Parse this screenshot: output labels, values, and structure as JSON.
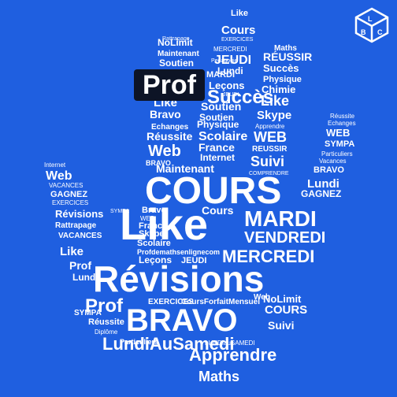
{
  "colors": {
    "background": "#1f5fe0",
    "text": "#ffffff",
    "badge": "#0d1426"
  },
  "badge": {
    "label": "Prof"
  },
  "logo": {
    "icon": "lbc-cube-logo",
    "letters": [
      "L",
      "B",
      "C"
    ]
  },
  "words": {
    "thumb": [
      "Like",
      "Cours",
      "EXERCICES",
      "MERCREDI",
      "JEUDI",
      "Lundi",
      "NoLimit",
      "Maintenant",
      "Soutien",
      "MARDI",
      "Leçons",
      "Pedagogie",
      "VENDREDI",
      "Rattrapage"
    ],
    "index": [
      "Like",
      "JEUDI",
      "MERCREDI",
      "Pedagogie",
      "Leçons",
      "Like",
      "Succès",
      "Soutien",
      "Physique",
      "Scolaire",
      "France",
      "Internet",
      "Maintenant"
    ],
    "middle": [
      "Maths",
      "RÉUSSIR",
      "Maths",
      "Succès",
      "Physique",
      "Chimie",
      "Like",
      "Skype",
      "Apprendre",
      "WEB",
      "REUSSIR",
      "Suivi",
      "MERCREDI",
      "COMPRENDRE"
    ],
    "ring": [
      "Réussite",
      "Echanges",
      "WEB",
      "SYMPA",
      "Particuliers",
      "Vacances",
      "BRAVO",
      "Lundi",
      "GAGNEZ",
      "Chimie"
    ],
    "pinky": [
      "Internet",
      "Web",
      "VACANCES",
      "GAGNEZ",
      "EXERCICES",
      "Révisions",
      "Rattrapage",
      "VACANCES",
      "Révisions",
      "Like",
      "Prof",
      "Lundi"
    ],
    "left": [
      "Bravo",
      "Echanges",
      "Réussite",
      "Web",
      "BRAVO",
      "Maintenant"
    ],
    "palm": [
      "COURS",
      "Like",
      "MARDI",
      "VENDREDI",
      "MERCREDI",
      "Révisions",
      "Prof",
      "Cours",
      "Bravo",
      "WEB",
      "France",
      "Skype",
      "Scolaire",
      "Profdemathsenlignecom",
      "Leçons",
      "JEUDI",
      "Succès",
      "SYMPA",
      "Leçons"
    ],
    "bottom": [
      "BRAVO",
      "LundiAuSamedi",
      "Apprendre",
      "Maths",
      "NoLimit",
      "COURS",
      "Suivi",
      "Diplôme",
      "Réussite",
      "SYMPA",
      "INTERNET",
      "Particuliers",
      "Maths",
      "Skype",
      "Chimie",
      "CoursForfaitMensuel",
      "LUNDIauSAMEDI",
      "Prof",
      "Web",
      "EXERCICES"
    ]
  }
}
